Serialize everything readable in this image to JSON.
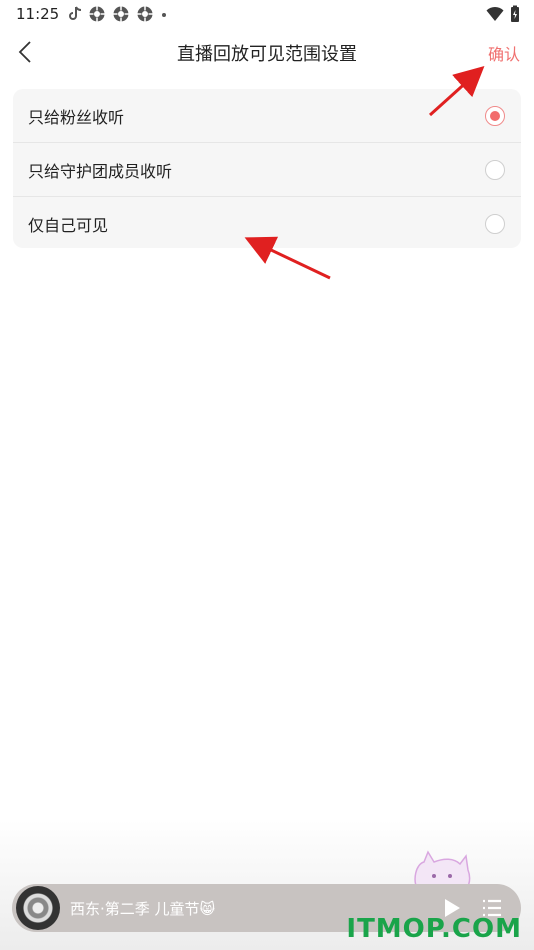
{
  "status_bar": {
    "time": "11:25",
    "icons_left": [
      "tiktok-icon",
      "aperture-icon",
      "aperture-icon",
      "aperture-icon",
      "dot"
    ],
    "icons_right": [
      "wifi-icon",
      "battery-icon"
    ]
  },
  "header": {
    "title": "直播回放可见范围设置",
    "confirm_label": "确认",
    "back_icon": "chevron-left-icon"
  },
  "options": [
    {
      "label": "只给粉丝收听",
      "selected": true
    },
    {
      "label": "只给守护团成员收听",
      "selected": false
    },
    {
      "label": "仅自己可见",
      "selected": false
    }
  ],
  "player": {
    "title": "西东·第二季 儿童节😸",
    "play_icon": "play-icon",
    "playlist_icon": "playlist-icon"
  },
  "watermark": "ITMOP.COM",
  "colors": {
    "accent": "#f26d6d",
    "confirm": "#f0706f",
    "annotation_arrow": "#e02020",
    "watermark": "#1aa44a"
  }
}
